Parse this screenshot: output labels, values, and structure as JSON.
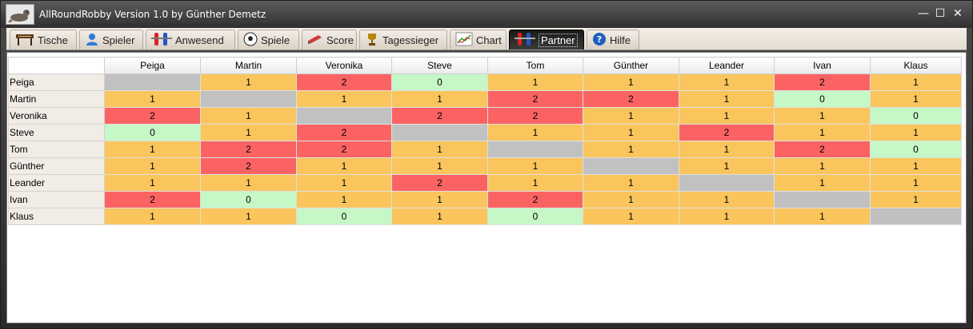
{
  "window": {
    "title": "AllRoundRobby Version 1.0 by Günther Demetz",
    "controls": {
      "minimize": "—",
      "maximize": "☐",
      "close": "✕"
    }
  },
  "tabs": [
    {
      "label": "Tische",
      "icon": "table-icon",
      "active": false
    },
    {
      "label": "Spieler",
      "icon": "player-icon",
      "active": false
    },
    {
      "label": "Anwesend",
      "icon": "foosball-figures-icon",
      "active": false
    },
    {
      "label": "Spiele",
      "icon": "soccer-ball-icon",
      "active": false
    },
    {
      "label": "Score",
      "icon": "score-pen-icon",
      "active": false
    },
    {
      "label": "Tagessieger",
      "icon": "trophy-icon",
      "active": false
    },
    {
      "label": "Chart",
      "icon": "chart-icon",
      "active": false
    },
    {
      "label": "Partner",
      "icon": "foosball-figures-icon",
      "active": true
    },
    {
      "label": "Hilfe",
      "icon": "help-icon",
      "active": false
    }
  ],
  "colors": {
    "zero": "#c6f7c6",
    "one": "#f9c55c",
    "two": "#fb6363",
    "self": "#c1c1c1"
  },
  "matrix": {
    "players": [
      "Peiga",
      "Martin",
      "Veronika",
      "Steve",
      "Tom",
      "Günther",
      "Leander",
      "Ivan",
      "Klaus"
    ],
    "values": [
      [
        null,
        1,
        2,
        0,
        1,
        1,
        1,
        2,
        1
      ],
      [
        1,
        null,
        1,
        1,
        2,
        2,
        1,
        0,
        1
      ],
      [
        2,
        1,
        null,
        2,
        2,
        1,
        1,
        1,
        0
      ],
      [
        0,
        1,
        2,
        null,
        1,
        1,
        2,
        1,
        1
      ],
      [
        1,
        2,
        2,
        1,
        null,
        1,
        1,
        2,
        0
      ],
      [
        1,
        2,
        1,
        1,
        1,
        null,
        1,
        1,
        1
      ],
      [
        1,
        1,
        1,
        2,
        1,
        1,
        null,
        1,
        1
      ],
      [
        2,
        0,
        1,
        1,
        2,
        1,
        1,
        null,
        1
      ],
      [
        1,
        1,
        0,
        1,
        0,
        1,
        1,
        1,
        null
      ]
    ]
  }
}
